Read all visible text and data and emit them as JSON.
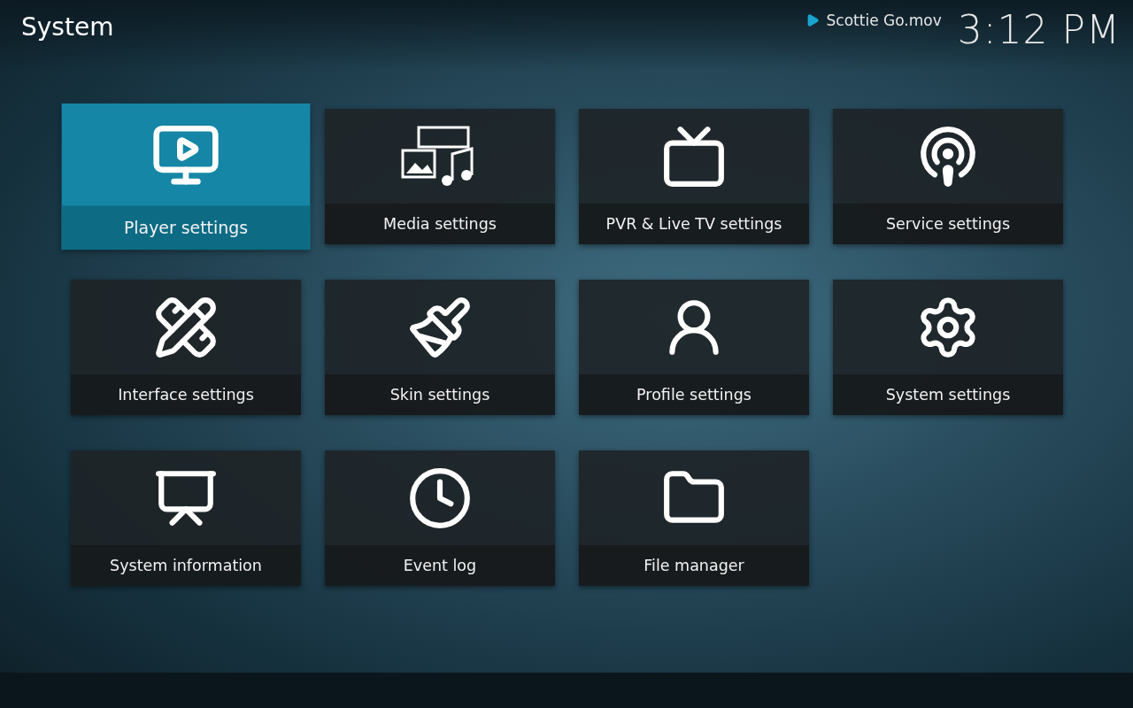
{
  "header": {
    "title": "System",
    "now_playing": {
      "title": "Scottie Go.mov",
      "playing": true
    },
    "clock": "3:12 PM"
  },
  "tiles": [
    {
      "label": "Player settings",
      "kind": "player",
      "selected": true
    },
    {
      "label": "Media settings",
      "kind": "media",
      "selected": false
    },
    {
      "label": "PVR & Live TV settings",
      "kind": "tv",
      "selected": false
    },
    {
      "label": "Service settings",
      "kind": "service",
      "selected": false
    },
    {
      "label": "Interface settings",
      "kind": "interface",
      "selected": false
    },
    {
      "label": "Skin settings",
      "kind": "skin",
      "selected": false
    },
    {
      "label": "Profile settings",
      "kind": "profile",
      "selected": false
    },
    {
      "label": "System settings",
      "kind": "system",
      "selected": false
    },
    {
      "label": "System information",
      "kind": "info",
      "selected": false
    },
    {
      "label": "Event log",
      "kind": "log",
      "selected": false
    },
    {
      "label": "File manager",
      "kind": "files",
      "selected": false
    }
  ]
}
